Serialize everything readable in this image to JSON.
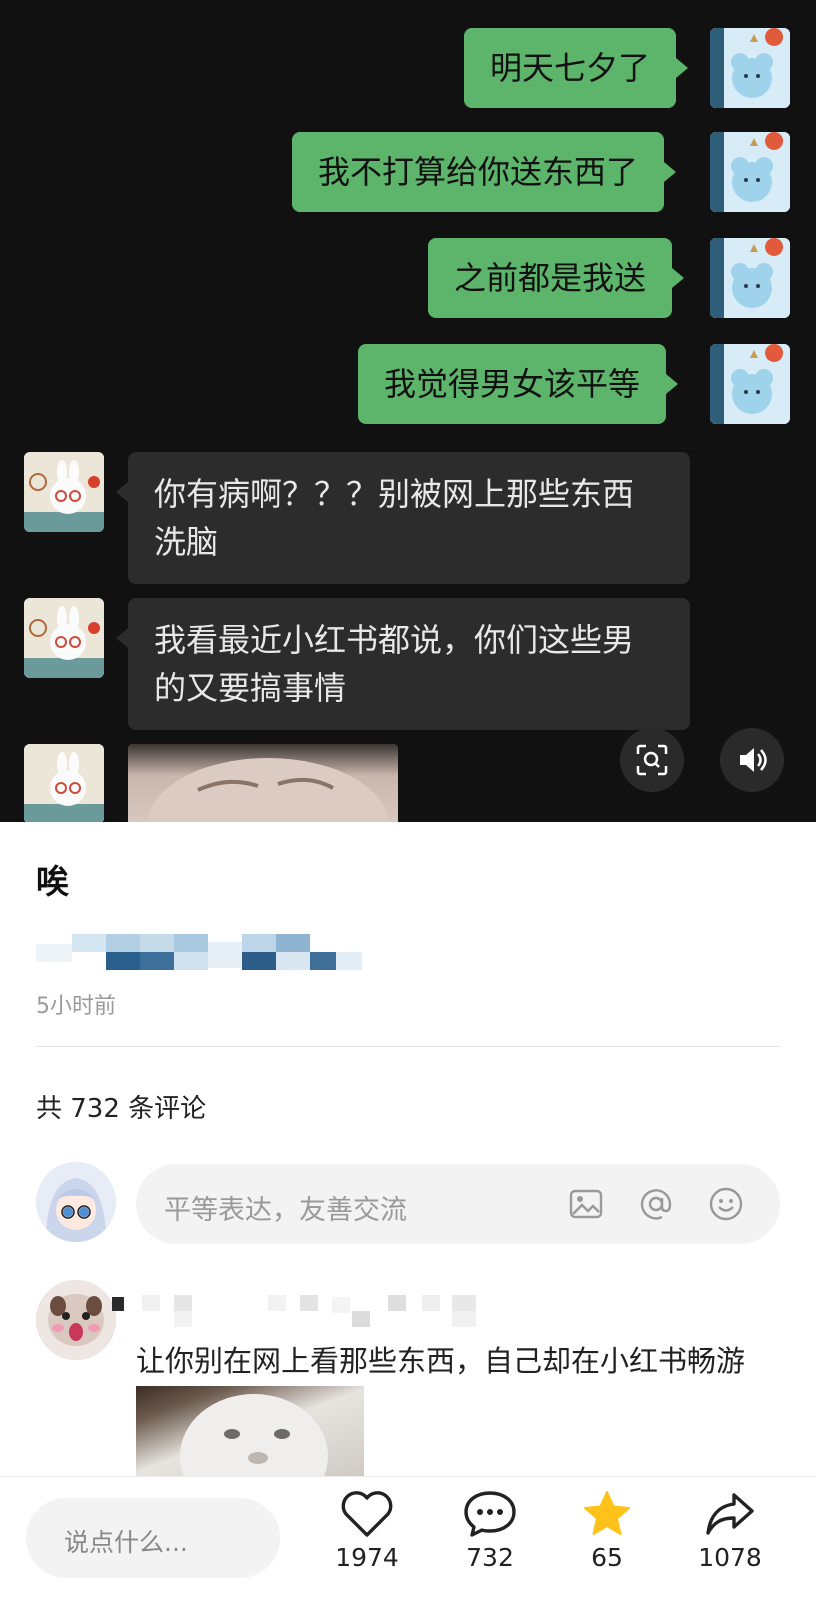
{
  "chat": {
    "messages_out": [
      {
        "text": "明天七夕了"
      },
      {
        "text": "我不打算给你送东西了"
      },
      {
        "text": "之前都是我送"
      },
      {
        "text": "我觉得男女该平等"
      }
    ],
    "messages_in": [
      {
        "text": "你有病啊？？？别被网上那些东西洗脑"
      },
      {
        "text": "我看最近小红书都说，你们这些男的又要搞事情"
      }
    ],
    "out_bubble_color": "#5cb56a",
    "in_bubble_color": "#2c2c2c"
  },
  "post": {
    "title": "唉",
    "time": "5小时前"
  },
  "comments_header": "共 732 条评论",
  "comment_input": {
    "placeholder": "平等表达，友善交流"
  },
  "comments": [
    {
      "text": "让你别在网上看那些东西，自己却在小红书畅游"
    }
  ],
  "bottom_bar": {
    "input_placeholder": "说点什么...",
    "likes": "1974",
    "comments": "732",
    "stars": "65",
    "shares": "1078",
    "star_color": "#ffc21a"
  }
}
